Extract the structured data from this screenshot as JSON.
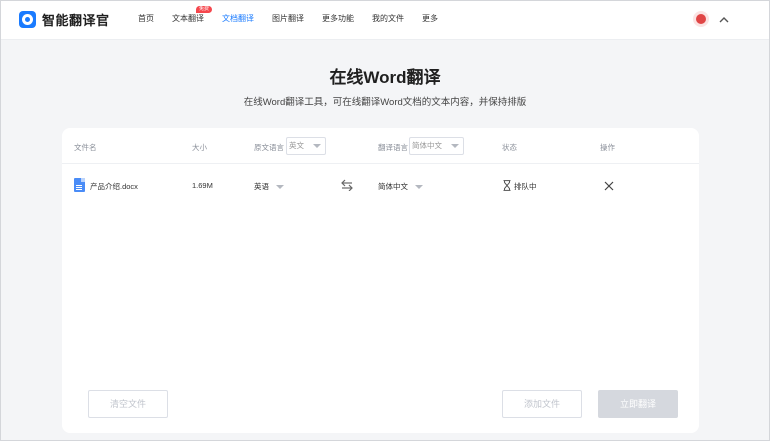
{
  "app": {
    "name": "智能翻译官"
  },
  "nav": {
    "items": [
      {
        "label": "首页"
      },
      {
        "label": "文本翻译",
        "badge": "免费"
      },
      {
        "label": "文档翻译",
        "active": true
      },
      {
        "label": "图片翻译"
      },
      {
        "label": "更多功能"
      },
      {
        "label": "我的文件"
      },
      {
        "label": "更多"
      }
    ]
  },
  "page": {
    "title": "在线Word翻译",
    "subtitle": "在线Word翻译工具，可在线翻译Word文档的文本内容，并保持排版"
  },
  "table": {
    "headers": {
      "filename": "文件名",
      "size": "大小",
      "source_lang": "原文语言",
      "source_select": "英文",
      "target_lang": "翻译语言",
      "target_select": "简体中文",
      "status": "状态",
      "action": "操作"
    },
    "rows": [
      {
        "filename": "产品介绍.docx",
        "size": "1.69M",
        "source": "英语",
        "target": "简体中文",
        "status": "排队中"
      }
    ]
  },
  "buttons": {
    "clear": "清空文件",
    "add": "添加文件",
    "translate": "立即翻译"
  },
  "colors": {
    "accent": "#1a7bff",
    "badge": "#f5474d",
    "disabled": "#d5d8de"
  }
}
